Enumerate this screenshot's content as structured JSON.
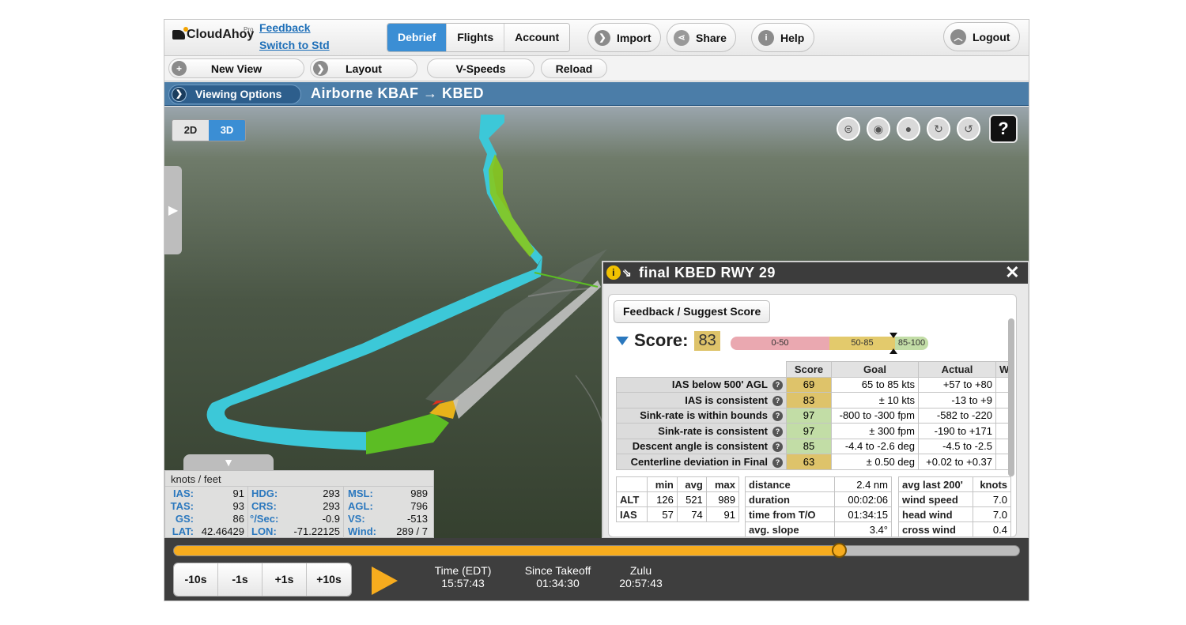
{
  "header": {
    "logo_name": "CloudAhoy",
    "logo_suffix": "Pro",
    "feedback_link": "Feedback",
    "switch_link": "Switch to Std",
    "tabs": [
      "Debrief",
      "Flights",
      "Account"
    ],
    "active_tab": "Debrief",
    "import_label": "Import",
    "share_label": "Share",
    "help_label": "Help",
    "logout_label": "Logout"
  },
  "toolbar": {
    "new_view": "New View",
    "layout": "Layout",
    "vspeeds": "V-Speeds",
    "reload": "Reload"
  },
  "view": {
    "viewing_options": "Viewing Options",
    "title": "Airborne KBAF → KBED",
    "mode_2d": "2D",
    "mode_3d": "3D",
    "active_mode": "3D",
    "help": "?"
  },
  "databox": {
    "units": "knots / feet",
    "col1": [
      [
        "IAS:",
        "91"
      ],
      [
        "TAS:",
        "93"
      ],
      [
        "GS:",
        "86"
      ],
      [
        "LAT:",
        "42.46429"
      ]
    ],
    "col2": [
      [
        "HDG:",
        "293"
      ],
      [
        "CRS:",
        "293"
      ],
      [
        "°/Sec:",
        "-0.9"
      ],
      [
        "LON:",
        "-71.22125"
      ]
    ],
    "col3": [
      [
        "MSL:",
        "989"
      ],
      [
        "AGL:",
        "796"
      ],
      [
        "VS:",
        "-513"
      ],
      [
        "Wind:",
        "289 / 7"
      ]
    ]
  },
  "panel": {
    "title": "final KBED RWY 29",
    "feedback_button": "Feedback / Suggest Score",
    "score_label": "Score:",
    "score_value": "83",
    "score_bands": [
      "0-50",
      "50-85",
      "85-100"
    ],
    "columns": [
      "Score",
      "Goal",
      "Actual",
      "W"
    ],
    "rows": [
      {
        "name": "IAS below 500' AGL",
        "score": "69",
        "goal": "65 to 85 kts",
        "actual": "+57 to +80",
        "color": "#dec36a"
      },
      {
        "name": "IAS is consistent",
        "score": "83",
        "goal": "± 10 kts",
        "actual": "-13 to +9",
        "color": "#dec36a"
      },
      {
        "name": "Sink-rate is within bounds",
        "score": "97",
        "goal": "-800 to -300 fpm",
        "actual": "-582 to -220",
        "color": "#c2dda6"
      },
      {
        "name": "Sink-rate is consistent",
        "score": "97",
        "goal": "± 300 fpm",
        "actual": "-190 to +171",
        "color": "#c2dda6"
      },
      {
        "name": "Descent angle is consistent",
        "score": "85",
        "goal": "-4.4 to -2.6 deg",
        "actual": "-4.5 to -2.5",
        "color": "#c2dda6"
      },
      {
        "name": "Centerline deviation in Final",
        "score": "63",
        "goal": "± 0.50 deg",
        "actual": "+0.02 to +0.37",
        "color": "#dec36a"
      }
    ],
    "stats": {
      "headers": [
        "",
        "min",
        "avg",
        "max"
      ],
      "rows": [
        [
          "ALT",
          "126",
          "521",
          "989"
        ],
        [
          "IAS",
          "57",
          "74",
          "91"
        ]
      ]
    },
    "segment": [
      [
        "distance",
        "2.4 nm"
      ],
      [
        "duration",
        "00:02:06"
      ],
      [
        "time from T/O",
        "01:34:15"
      ],
      [
        "avg. slope",
        "3.4°"
      ]
    ],
    "wind": {
      "header": [
        "avg last 200'",
        "knots"
      ],
      "rows": [
        [
          "wind speed",
          "7.0"
        ],
        [
          "head wind",
          "7.0"
        ],
        [
          "cross wind",
          "0.4"
        ]
      ]
    }
  },
  "playback": {
    "progress": 0.787,
    "steps": [
      "-10s",
      "-1s",
      "+1s",
      "+10s"
    ],
    "time_label": "Time (EDT)",
    "time_value": "15:57:43",
    "since_label": "Since Takeoff",
    "since_value": "01:34:30",
    "zulu_label": "Zulu",
    "zulu_value": "20:57:43"
  },
  "colors": {
    "accent": "#3b8ed4",
    "header_band": "#4b7da8",
    "flight_path_high": "#3cc8d8",
    "flight_path_final": "#6cc22c",
    "progress": "#f7ac1e"
  }
}
